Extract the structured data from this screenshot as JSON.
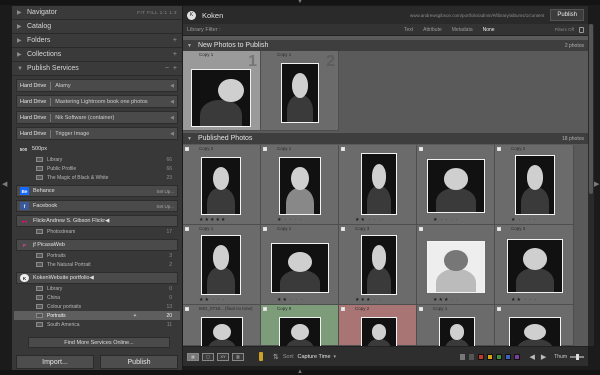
{
  "left_panel": {
    "navigator": {
      "label": "Navigator",
      "modes": "FIT  FILL  1:1  1:3"
    },
    "catalog": {
      "label": "Catalog"
    },
    "folders": {
      "label": "Folders"
    },
    "collections": {
      "label": "Collections"
    },
    "publish_services": {
      "label": "Publish Services",
      "minus": "−",
      "plus": "+"
    },
    "hard_drive_services": [
      {
        "name": "Hard Drive",
        "sub": "Alamy"
      },
      {
        "name": "Hard Drive",
        "sub": "Mastering Lightroom book one photos"
      },
      {
        "name": "Hard Drive",
        "sub": "Nik Software (container)"
      },
      {
        "name": "Hard Drive",
        "sub": "Trigger Image"
      }
    ],
    "five_hundred_px": {
      "logo": "500",
      "name": "500px",
      "items": [
        {
          "label": "Library",
          "count": "66"
        },
        {
          "label": "Public Profile",
          "count": "66"
        },
        {
          "label": "The Magic of Black & White",
          "count": "23"
        }
      ]
    },
    "behance": {
      "logo": "Be",
      "name": "Behance",
      "setup": "Set Up..."
    },
    "facebook": {
      "logo": "f",
      "name": "Facebook",
      "setup": "Set Up..."
    },
    "flickr": {
      "logo": "●●",
      "name": "Flickr",
      "sub": "Andrew S. Gibson Flickr",
      "items": [
        {
          "label": "Photostream",
          "count": "17"
        }
      ]
    },
    "picasa": {
      "logo": "P",
      "name": "jf PicasaWeb",
      "items": [
        {
          "label": "Portraits",
          "count": "3"
        },
        {
          "label": "The Natural Portrait",
          "count": "2"
        }
      ]
    },
    "koken": {
      "logo": "K",
      "name": "Koken",
      "sub": "Website portfolio",
      "items": [
        {
          "label": "Library",
          "count": "0"
        },
        {
          "label": "China",
          "count": "0"
        },
        {
          "label": "Colour portraits",
          "count": "13"
        },
        {
          "label": "Portraits",
          "count": "20",
          "selected": true,
          "marker": "+"
        },
        {
          "label": "South America",
          "count": "11"
        }
      ]
    },
    "find_more": "Find More Services Online...",
    "import_label": "Import...",
    "publish_label": "Publish"
  },
  "top_bar": {
    "logo": "K",
    "title": "Koken",
    "url": "www.andrewsgibson.com/portfolio/admin/#/library/albums/1/content",
    "publish_label": "Publish"
  },
  "filter_bar": {
    "label": "Library Filter :",
    "options": [
      "Text",
      "Attribute",
      "Metadata",
      "None"
    ],
    "active_option": "None",
    "filters_off": "Filters Off"
  },
  "new_photos": {
    "title": "New Photos to Publish",
    "count": "2 photos",
    "cells": [
      {
        "label": "Copy 1",
        "num": "1",
        "selected": true
      },
      {
        "label": "Copy 1",
        "num": "2",
        "selected": false
      }
    ]
  },
  "published": {
    "title": "Published Photos",
    "count": "18 photos",
    "cells": [
      {
        "label": "Copy 2",
        "num": "",
        "stars": "★★★★★"
      },
      {
        "label": "Copy 1",
        "num": "",
        "stars": "★ · · · ·"
      },
      {
        "label": "",
        "num": "",
        "stars": "★★ · · ·"
      },
      {
        "label": "",
        "num": "",
        "stars": "★ · · · ·"
      },
      {
        "label": "Copy 2",
        "num": "",
        "stars": "★ · · · ·"
      },
      {
        "label": "Copy 1",
        "num": "",
        "stars": "★★ · · ·"
      },
      {
        "label": "Copy 1",
        "num": "",
        "stars": "★★ · · ·"
      },
      {
        "label": "Copy 3",
        "num": "",
        "stars": "★★★ · ·"
      },
      {
        "label": "",
        "num": "",
        "stars": "★★★ · ·"
      },
      {
        "label": "Copy 3",
        "num": "",
        "stars": "★★ · · ·"
      },
      {
        "label": "IMG_0719... (final no tone)",
        "num": "",
        "stars": ""
      },
      {
        "label": "Copy 9",
        "num": "",
        "stars": "",
        "color": "green"
      },
      {
        "label": "Copy 2",
        "num": "",
        "stars": "",
        "color": "red"
      },
      {
        "label": "Copy 1",
        "num": "",
        "stars": ""
      },
      {
        "label": "",
        "num": "",
        "stars": ""
      }
    ]
  },
  "toolbar": {
    "sort_label": "Sort:",
    "sort_value": "Capture Time",
    "thumbnails_label": "Thum",
    "view_icons": [
      "▦",
      "▢",
      "XY",
      "▥"
    ],
    "label_colors": [
      "#c0392b",
      "#d4a017",
      "#3f8f3f",
      "#3c63b8",
      "#7b3fa0"
    ]
  }
}
